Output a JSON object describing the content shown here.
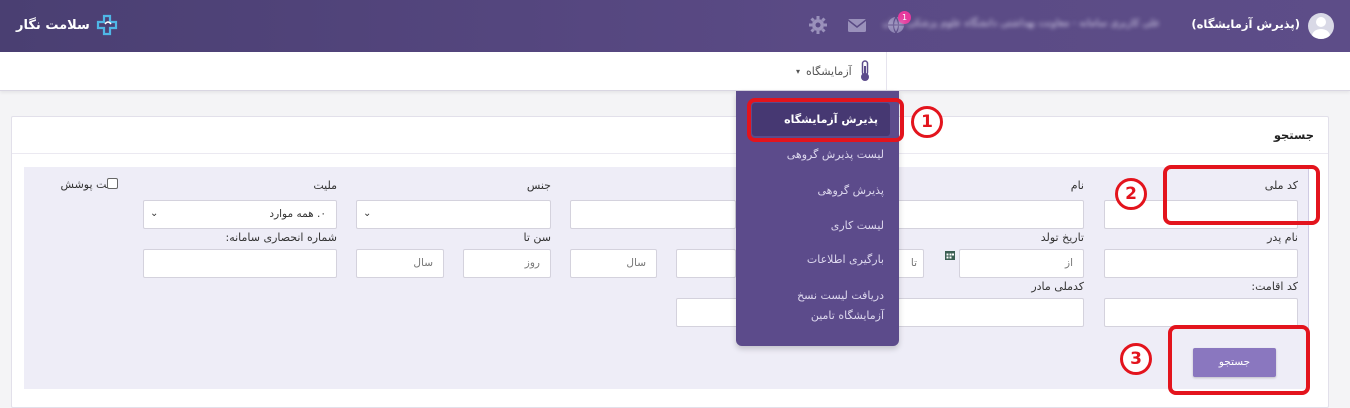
{
  "topbar": {
    "app_name": "سلامت نگار",
    "user_role": "(پذیرش آزمایشگاه)",
    "user_name": "علی کاربری سامانه - معاونت بهداشتی دانشگاه علوم پزشکی ایران",
    "notification_count": "1",
    "icons": [
      "settings-icon",
      "mail-icon",
      "globe-icon",
      "avatar-icon"
    ]
  },
  "subnav": {
    "menu_label": "آزمایشگاه"
  },
  "dropdown": {
    "active_item": "پذیرش آزمایشگاه",
    "items": [
      "لیست پذیرش گروهی",
      "پذیرش گروهی",
      "لیست کاری",
      "بارگیری اطلاعات"
    ],
    "last_item_line1": "دریافت لیست نسخ",
    "last_item_line2": "آزمایشگاه تامین"
  },
  "panel": {
    "title": "جستجو"
  },
  "form": {
    "national_code_label": "کد ملی",
    "name_label": "نام",
    "gender_label": "جنس",
    "nationality_label": "ملیت",
    "nationality_value": "۰. همه موارد",
    "insured_label": "تحت پوشش",
    "father_name_label": "نام پدر",
    "birth_date_label": "تاریخ تولد",
    "birth_from_placeholder": "از",
    "birth_to_placeholder": "تا",
    "age_to_label": "سن تا",
    "age_year_placeholder": "سال",
    "age_day_placeholder": "روز",
    "age_year2_placeholder": "سال",
    "exclusive_id_label": "شماره انحصاری سامانه:",
    "mother_code_label": "کدملی مادر",
    "residence_code_label": "کد اقامت:",
    "search_button": "جستجو"
  },
  "annotations": {
    "step1": "1",
    "step2": "2",
    "step3": "3",
    "color": "#e3141d"
  },
  "colors": {
    "header": "#4a3f72",
    "dropdown": "#5c4b8b",
    "button": "#8a77bf"
  }
}
